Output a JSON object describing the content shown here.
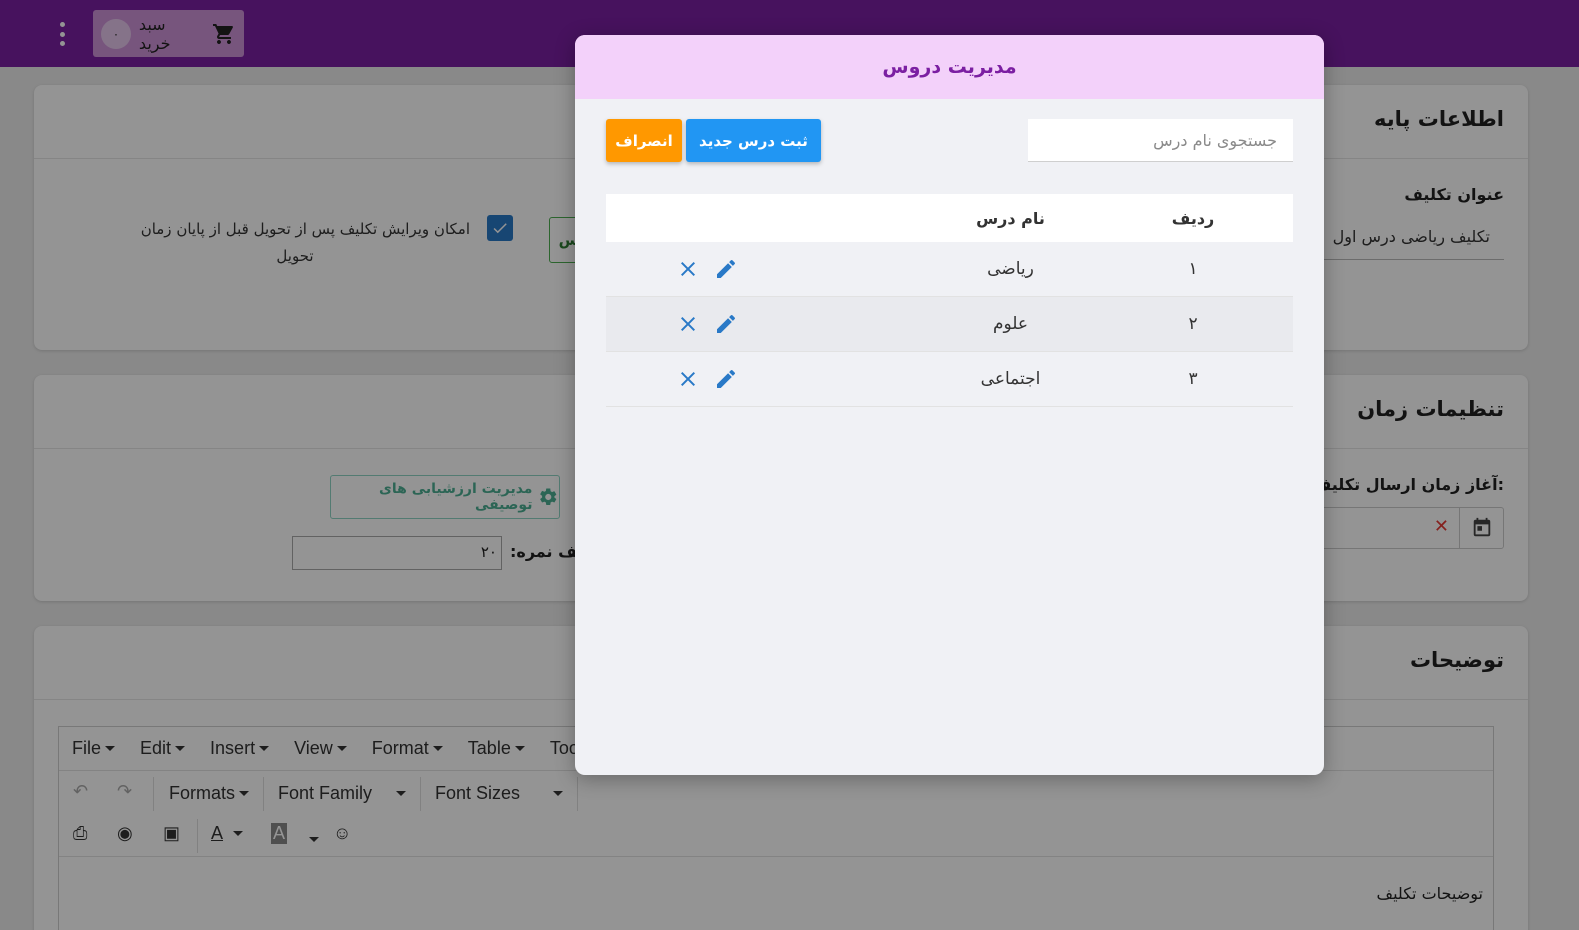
{
  "topbar": {
    "cart_label": "سبد خرید",
    "cart_count": "۰"
  },
  "basic_info": {
    "title": "اطلاعات پایه",
    "assignment_title_label": "عنوان تکلیف",
    "assignment_title_value": "تکلیف ریاضی درس اول",
    "edit_option_label_line1": "امکان ویرایش تکلیف پس از تحویل قبل از پایان زمان",
    "edit_option_label_line2": "تحویل",
    "partial_button_text": "س"
  },
  "time_settings": {
    "title": "تنظیمات زمان",
    "start_label": "آغاز زمان ارسال تکلیف:",
    "manage_evaluations_button": "مدیریت ارزشیابی های توصیفی",
    "max_score_label": "سقف نمره:",
    "max_score_value": "۲۰"
  },
  "description": {
    "title": "توضیحات",
    "menu": [
      "File",
      "Edit",
      "Insert",
      "View",
      "Format",
      "Table",
      "Tools"
    ],
    "formats_label": "Formats",
    "font_family_label": "Font Family",
    "font_sizes_label": "Font Sizes",
    "body_text": "توضیحات تکلیف"
  },
  "modal": {
    "title": "مدیریت دروس",
    "search_placeholder": "جستجوی نام درس",
    "new_button": "ثبت درس جدید",
    "cancel_button": "انصراف",
    "columns": {
      "row": "ردیف",
      "name": "نام درس"
    },
    "rows": [
      {
        "index": "۱",
        "name": "ریاضی"
      },
      {
        "index": "۲",
        "name": "علوم"
      },
      {
        "index": "۳",
        "name": "اجتماعی"
      }
    ]
  },
  "colors": {
    "topbar": "#7b1fa2",
    "modal_header": "#f3d1fa",
    "primary_button": "#2196f3",
    "cancel_button": "#ff9800",
    "action_icons": "#2979c7"
  },
  "icons": [
    "cart-icon",
    "more-vert-icon",
    "check-icon",
    "gear-icon",
    "calendar-icon",
    "clear-icon",
    "edit-icon",
    "close-icon"
  ]
}
